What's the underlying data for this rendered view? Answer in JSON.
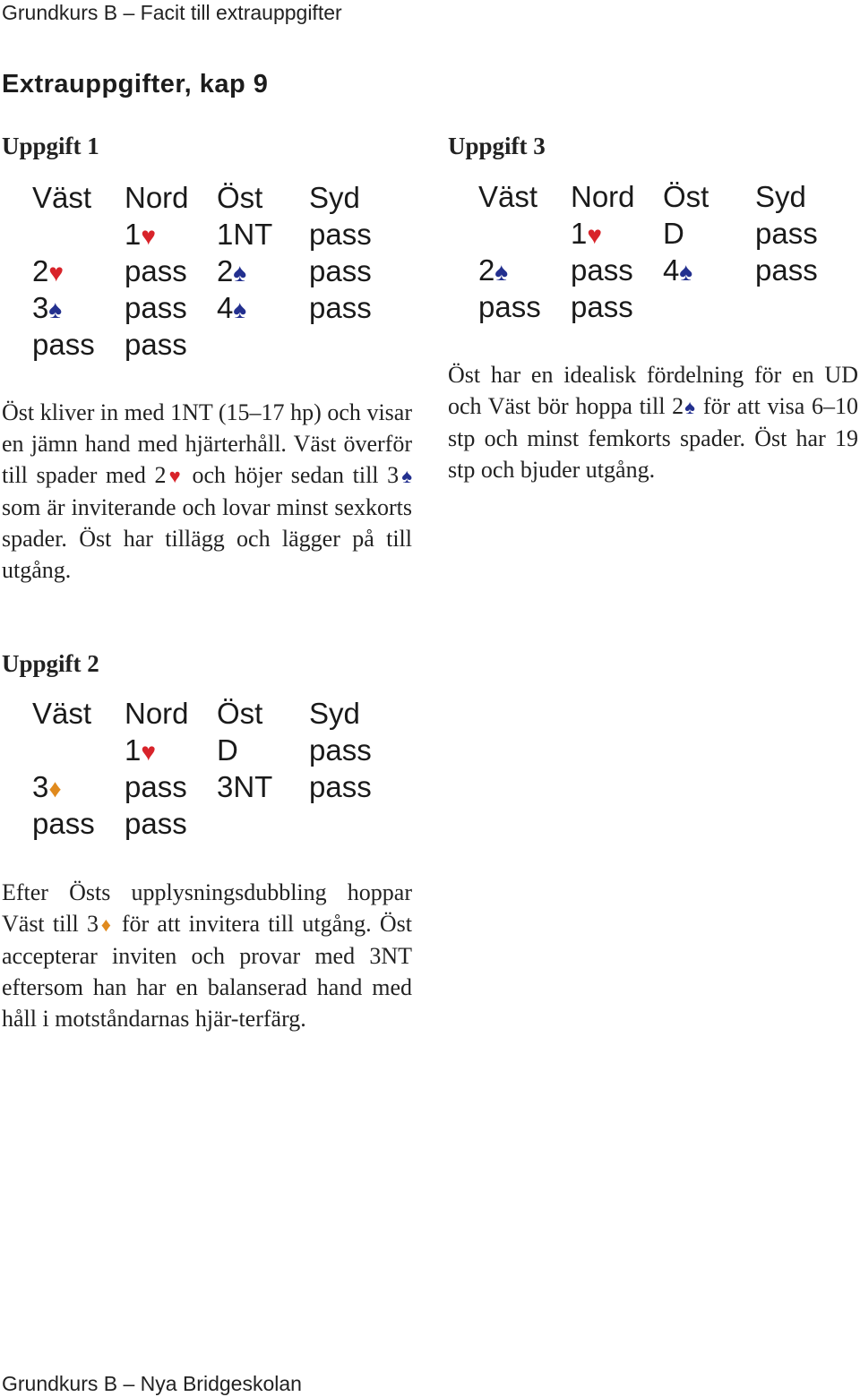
{
  "header": {
    "text": "Grundkurs B – Facit till extrauppgifter"
  },
  "chapter_title": "Extrauppgifter, kap 9",
  "suit_colors": {
    "hearts": "#d8232a",
    "spades": "#23308f",
    "diamonds": "#e08a1e"
  },
  "exercises": [
    {
      "title": "Uppgift 1",
      "columns": [
        "Väst",
        "Nord",
        "Öst",
        "Syd"
      ],
      "rows": [
        [
          {
            "text": ""
          },
          {
            "text": "1",
            "suit": "hearts"
          },
          {
            "text": "1NT"
          },
          {
            "text": "pass"
          }
        ],
        [
          {
            "text": "2",
            "suit": "hearts"
          },
          {
            "text": "pass"
          },
          {
            "text": "2",
            "suit": "spades"
          },
          {
            "text": "pass"
          }
        ],
        [
          {
            "text": "3",
            "suit": "spades"
          },
          {
            "text": "pass"
          },
          {
            "text": "4",
            "suit": "spades"
          },
          {
            "text": "pass"
          }
        ],
        [
          {
            "text": "pass"
          },
          {
            "text": "pass"
          },
          {
            "text": ""
          },
          {
            "text": ""
          }
        ]
      ],
      "explanation": [
        {
          "text": "Öst kliver in med 1NT (15–17 hp) och visar en jämn hand med hjärterhåll. Väst överför till spader med 2"
        },
        {
          "suit": "hearts"
        },
        {
          "text": " och höjer sedan till 3"
        },
        {
          "suit": "spades"
        },
        {
          "text": " som är inviterande och lovar minst sexkorts spader. Öst har tillägg och lägger på till utgång."
        }
      ]
    },
    {
      "title": "Uppgift 2",
      "columns": [
        "Väst",
        "Nord",
        "Öst",
        "Syd"
      ],
      "rows": [
        [
          {
            "text": ""
          },
          {
            "text": "1",
            "suit": "hearts"
          },
          {
            "text": "D"
          },
          {
            "text": "pass"
          }
        ],
        [
          {
            "text": "3",
            "suit": "diamonds"
          },
          {
            "text": "pass"
          },
          {
            "text": "3NT"
          },
          {
            "text": "pass"
          }
        ],
        [
          {
            "text": "pass"
          },
          {
            "text": "pass"
          },
          {
            "text": ""
          },
          {
            "text": ""
          }
        ]
      ],
      "explanation": [
        {
          "text": "Efter Östs upplysningsdubbling hoppar Väst till 3"
        },
        {
          "suit": "diamonds"
        },
        {
          "text": " för att invitera till utgång. Öst accepterar inviten och provar med 3NT eftersom han har en balanserad hand med håll i motståndarnas hjär-terfärg."
        }
      ]
    },
    {
      "title": "Uppgift 3",
      "columns": [
        "Väst",
        "Nord",
        "Öst",
        "Syd"
      ],
      "rows": [
        [
          {
            "text": ""
          },
          {
            "text": "1",
            "suit": "hearts"
          },
          {
            "text": "D"
          },
          {
            "text": "pass"
          }
        ],
        [
          {
            "text": "2",
            "suit": "spades"
          },
          {
            "text": "pass"
          },
          {
            "text": "4",
            "suit": "spades"
          },
          {
            "text": "pass"
          }
        ],
        [
          {
            "text": "pass"
          },
          {
            "text": "pass"
          },
          {
            "text": ""
          },
          {
            "text": ""
          }
        ]
      ],
      "explanation": [
        {
          "text": "Öst har en idealisk fördelning för en UD och Väst bör hoppa till 2"
        },
        {
          "suit": "spades"
        },
        {
          "text": " för att visa 6–10 stp och minst femkorts spader. Öst har 19 stp och bjuder utgång."
        }
      ]
    }
  ],
  "footer": {
    "text": "Grundkurs B – Nya Bridgeskolan"
  }
}
